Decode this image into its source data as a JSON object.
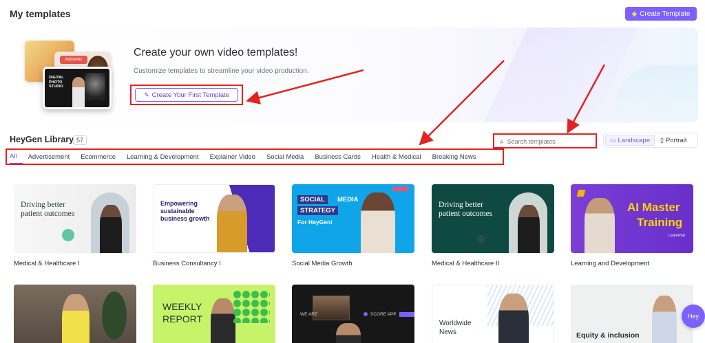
{
  "header": {
    "title": "My templates",
    "create_button": "Create Template"
  },
  "banner": {
    "title": "Create your own video templates!",
    "subtitle": "Customize templates to streamline your video production.",
    "first_button": "Create Your First Template",
    "thumb_authentic": "Authentic",
    "thumb_studio": "DIGITAL PHOTO STUDIO"
  },
  "library": {
    "title": "HeyGen Library",
    "count": "57",
    "search_placeholder": "Search templates",
    "orientation": {
      "landscape": "Landscape",
      "portrait": "Portrait",
      "selected": "Landscape"
    },
    "tabs": [
      {
        "label": "All",
        "active": true
      },
      {
        "label": "Advertisement"
      },
      {
        "label": "Ecommerce"
      },
      {
        "label": "Learning & Development"
      },
      {
        "label": "Explainer Video"
      },
      {
        "label": "Social Media"
      },
      {
        "label": "Business Cards"
      },
      {
        "label": "Health & Medical"
      },
      {
        "label": "Breaking News"
      }
    ]
  },
  "templates": [
    {
      "name": "Medical & Healthcare I",
      "headline": "Driving better patient outcomes"
    },
    {
      "name": "Business Consultancy I",
      "headline": "Empowering sustainable business growth"
    },
    {
      "name": "Social Media Growth",
      "headline_1": "SOCIAL",
      "headline_2": "MEDIA",
      "headline_3": "STRATEGY",
      "headline_4": "For HeyGen!"
    },
    {
      "name": "Medical & Healthcare II",
      "headline": "Driving better patient outcomes"
    },
    {
      "name": "Learning and Development",
      "headline_1": "AI Master",
      "headline_2": "Training",
      "brand": "LearnPad"
    },
    {
      "name": "",
      "headline": ""
    },
    {
      "name": "",
      "headline_1": "WEEKLY",
      "headline_2": "REPORT"
    },
    {
      "name": "",
      "headline_1": "WE ARE",
      "headline_2": "SCORE APP"
    },
    {
      "name": "",
      "headline_1": "Worldwide",
      "headline_2": "News"
    },
    {
      "name": "",
      "headline": "Equity & inclusion"
    }
  ],
  "assistant_badge": "Hey",
  "colors": {
    "accent": "#7b61ff",
    "annotation": "#e32222"
  }
}
